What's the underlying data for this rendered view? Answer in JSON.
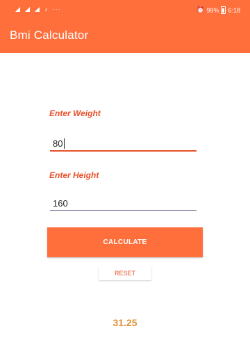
{
  "theme": {
    "accent": "#ff6f3c",
    "accent_dark": "#e8502a",
    "result_color": "#e0913a",
    "input_underline_active": "#e8502a",
    "input_underline_idle": "#7a7a99"
  },
  "status_bar": {
    "left_icons": [
      "signal-icon",
      "signal-icon",
      "signal-icon",
      "music-note-icon",
      "more-dots-icon"
    ],
    "right_icons": [
      "alarm-icon",
      "battery-icon"
    ],
    "battery_text": "99%",
    "time": "6:18"
  },
  "app_bar": {
    "title": "Bmi Calculator"
  },
  "form": {
    "weight_label": "Enter Weight",
    "weight_value": "80",
    "height_label": "Enter Height",
    "height_value": "160",
    "calculate_label": "CALCULATE",
    "reset_label": "RESET"
  },
  "result": {
    "value": "31.25"
  }
}
